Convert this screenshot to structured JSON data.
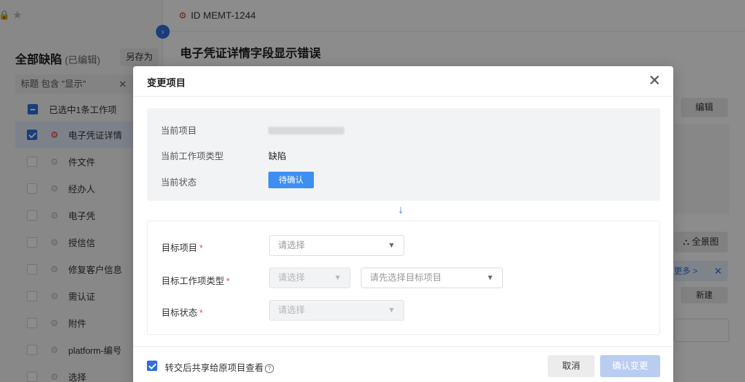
{
  "left": {
    "title": "全部缺陷",
    "title_sub": "(已编辑)",
    "save_as": "另存为",
    "filter_text": "标题 包含 \"显示\"",
    "filter_clear": "清",
    "selected_text": "已选中1条工作项",
    "items": [
      {
        "text": "电子凭证详情",
        "checked": true
      },
      {
        "text": "件文件",
        "checked": false
      },
      {
        "text": "经办人",
        "checked": false
      },
      {
        "text": "电子凭",
        "checked": false
      },
      {
        "text": "授信信",
        "checked": false
      },
      {
        "text": "修复客户信息",
        "checked": false
      },
      {
        "text": "需认证",
        "checked": false
      },
      {
        "text": "附件",
        "checked": false
      },
      {
        "text": "platform-编号",
        "checked": false
      },
      {
        "text": "选择",
        "checked": false
      }
    ]
  },
  "main": {
    "issue_id": "ID MEMT-1244",
    "title": "电子凭证详情字段显示错误",
    "edit": "编辑",
    "panorama": "全景图",
    "more": "更多 >",
    "new": "新建"
  },
  "modal": {
    "title": "变更项目",
    "current_project_label": "当前项目",
    "current_type_label": "当前工作项类型",
    "current_type_value": "缺陷",
    "current_status_label": "当前状态",
    "current_status_value": "待确认",
    "target_project_label": "目标项目",
    "target_type_label": "目标工作项类型",
    "target_status_label": "目标状态",
    "select_placeholder": "请选择",
    "select_project_first": "请先选择目标项目",
    "share_label": "转交后共享给原项目查看",
    "cancel": "取消",
    "confirm": "确认变更"
  },
  "colors": {
    "primary": "#2f6fdf",
    "status_tag": "#3f8ff0",
    "required": "#e5484d",
    "confirm_disabled": "#b9cdf0"
  }
}
